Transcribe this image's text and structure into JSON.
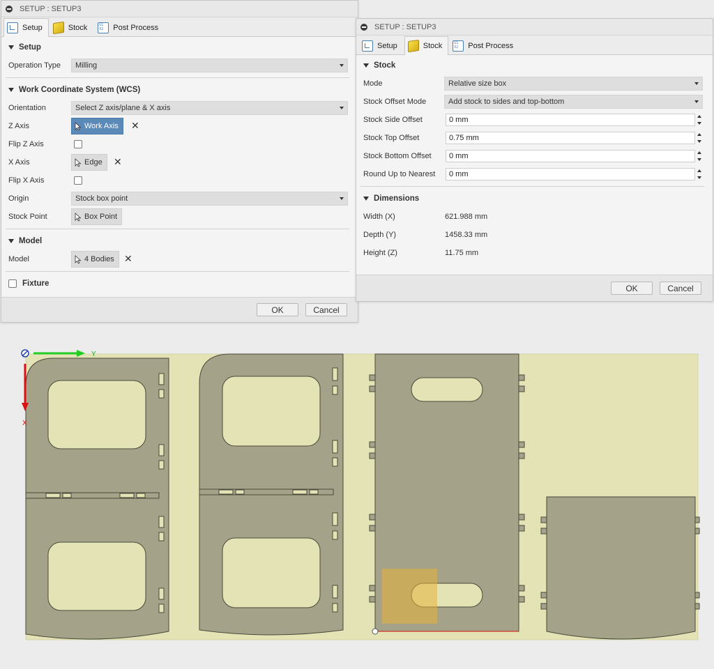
{
  "left_panel": {
    "title": "SETUP : SETUP3",
    "tabs": [
      {
        "label": "Setup"
      },
      {
        "label": "Stock"
      },
      {
        "label": "Post Process"
      }
    ],
    "setup_section": {
      "title": "Setup",
      "operation_type_label": "Operation Type",
      "operation_type_value": "Milling"
    },
    "wcs_section": {
      "title": "Work Coordinate System (WCS)",
      "orientation_label": "Orientation",
      "orientation_value": "Select Z axis/plane & X axis",
      "z_axis_label": "Z Axis",
      "z_axis_value": "Work Axis",
      "flip_z_label": "Flip Z Axis",
      "x_axis_label": "X Axis",
      "x_axis_value": "Edge",
      "flip_x_label": "Flip X Axis",
      "origin_label": "Origin",
      "origin_value": "Stock box point",
      "stock_point_label": "Stock Point",
      "stock_point_value": "Box Point"
    },
    "model_section": {
      "title": "Model",
      "model_label": "Model",
      "model_value": "4 Bodies"
    },
    "fixture_label": "Fixture",
    "ok_label": "OK",
    "cancel_label": "Cancel"
  },
  "right_panel": {
    "title": "SETUP : SETUP3",
    "tabs": [
      {
        "label": "Setup"
      },
      {
        "label": "Stock"
      },
      {
        "label": "Post Process"
      }
    ],
    "stock_section": {
      "title": "Stock",
      "mode_label": "Mode",
      "mode_value": "Relative size box",
      "offset_mode_label": "Stock Offset Mode",
      "offset_mode_value": "Add stock to sides and top-bottom",
      "side_offset_label": "Stock Side Offset",
      "side_offset_value": "0 mm",
      "top_offset_label": "Stock Top Offset",
      "top_offset_value": "0.75 mm",
      "bottom_offset_label": "Stock Bottom Offset",
      "bottom_offset_value": "0 mm",
      "round_up_label": "Round Up to Nearest",
      "round_up_value": "0 mm"
    },
    "dimensions_section": {
      "title": "Dimensions",
      "width_label": "Width (X)",
      "width_value": "621.988 mm",
      "depth_label": "Depth (Y)",
      "depth_value": "1458.33 mm",
      "height_label": "Height (Z)",
      "height_value": "11.75 mm"
    },
    "ok_label": "OK",
    "cancel_label": "Cancel"
  },
  "viewport": {
    "axis_y_label": "Y",
    "axis_x_label": "X",
    "colors": {
      "stock": "#e3e3b5",
      "part": "#a4a288",
      "part_edge": "#4a4a3a",
      "y_axis": "#22cc22",
      "x_axis": "#dd1111",
      "highlight": "#e8b23a"
    }
  }
}
